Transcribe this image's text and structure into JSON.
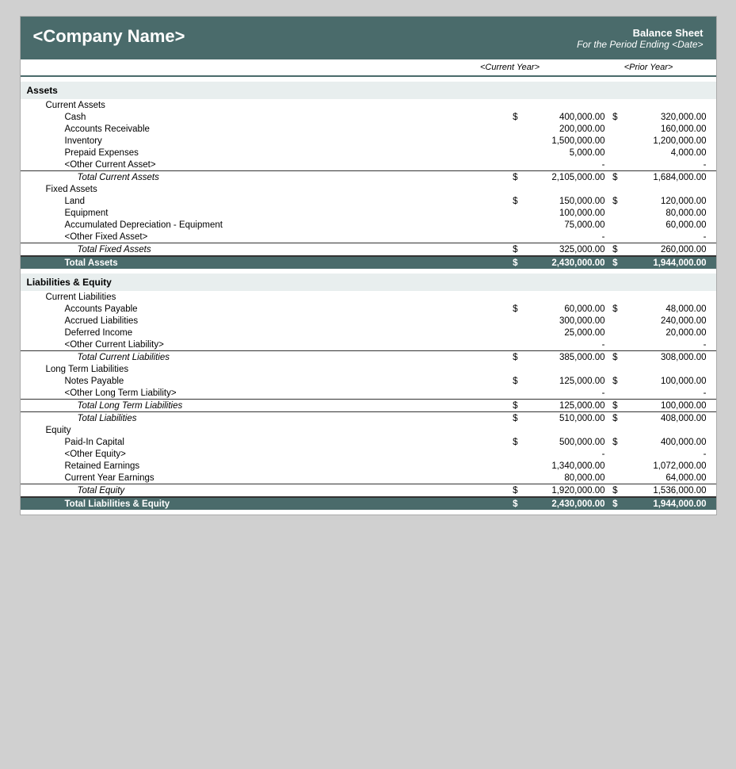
{
  "header": {
    "company": "<Company Name>",
    "sheet_title": "Balance Sheet",
    "sheet_subtitle": "For the Period Ending <Date>",
    "col_cy": "<Current Year>",
    "col_py": "<Prior Year>"
  },
  "sections": {
    "assets_label": "Assets",
    "current_assets_label": "Current Assets",
    "fixed_assets_label": "Fixed Assets",
    "liabilities_equity_label": "Liabilities & Equity",
    "current_liabilities_label": "Current Liabilities",
    "long_term_liabilities_label": "Long Term Liabilities",
    "equity_label": "Equity"
  },
  "rows": {
    "cash": {
      "label": "Cash",
      "cy": "400,000.00",
      "py": "320,000.00"
    },
    "ar": {
      "label": "Accounts Receivable",
      "cy": "200,000.00",
      "py": "160,000.00"
    },
    "inventory": {
      "label": "Inventory",
      "cy": "1,500,000.00",
      "py": "1,200,000.00"
    },
    "prepaid": {
      "label": "Prepaid Expenses",
      "cy": "5,000.00",
      "py": "4,000.00"
    },
    "other_current_asset": {
      "label": "<Other Current Asset>",
      "cy": "-",
      "py": "-"
    },
    "total_current_assets": {
      "label": "Total Current Assets",
      "cy": "2,105,000.00",
      "py": "1,684,000.00"
    },
    "land": {
      "label": "Land",
      "cy": "150,000.00",
      "py": "120,000.00"
    },
    "equipment": {
      "label": "Equipment",
      "cy": "100,000.00",
      "py": "80,000.00"
    },
    "accum_dep": {
      "label": "Accumulated Depreciation - Equipment",
      "cy": "75,000.00",
      "py": "60,000.00"
    },
    "other_fixed": {
      "label": "<Other Fixed Asset>",
      "cy": "-",
      "py": "-"
    },
    "total_fixed_assets": {
      "label": "Total Fixed Assets",
      "cy": "325,000.00",
      "py": "260,000.00"
    },
    "total_assets": {
      "label": "Total Assets",
      "cy": "2,430,000.00",
      "py": "1,944,000.00"
    },
    "ap": {
      "label": "Accounts Payable",
      "cy": "60,000.00",
      "py": "48,000.00"
    },
    "accrued": {
      "label": "Accrued Liabilities",
      "cy": "300,000.00",
      "py": "240,000.00"
    },
    "deferred": {
      "label": "Deferred Income",
      "cy": "25,000.00",
      "py": "20,000.00"
    },
    "other_current_liability": {
      "label": "<Other Current Liability>",
      "cy": "-",
      "py": "-"
    },
    "total_current_liabilities": {
      "label": "Total Current Liabilities",
      "cy": "385,000.00",
      "py": "308,000.00"
    },
    "notes_payable": {
      "label": "Notes Payable",
      "cy": "125,000.00",
      "py": "100,000.00"
    },
    "other_lt_liability": {
      "label": "<Other Long Term Liability>",
      "cy": "-",
      "py": "-"
    },
    "total_lt_liabilities": {
      "label": "Total Long Term Liabilities",
      "cy": "125,000.00",
      "py": "100,000.00"
    },
    "total_liabilities": {
      "label": "Total Liabilities",
      "cy": "510,000.00",
      "py": "408,000.00"
    },
    "paid_in_capital": {
      "label": "Paid-In Capital",
      "cy": "500,000.00",
      "py": "400,000.00"
    },
    "other_equity": {
      "label": "<Other Equity>",
      "cy": "-",
      "py": "-"
    },
    "retained_earnings": {
      "label": "Retained Earnings",
      "cy": "1,340,000.00",
      "py": "1,072,000.00"
    },
    "current_year_earnings": {
      "label": "Current Year Earnings",
      "cy": "80,000.00",
      "py": "64,000.00"
    },
    "total_equity": {
      "label": "Total Equity",
      "cy": "1,920,000.00",
      "py": "1,536,000.00"
    },
    "total_liab_equity": {
      "label": "Total Liabilities & Equity",
      "cy": "2,430,000.00",
      "py": "1,944,000.00"
    }
  }
}
